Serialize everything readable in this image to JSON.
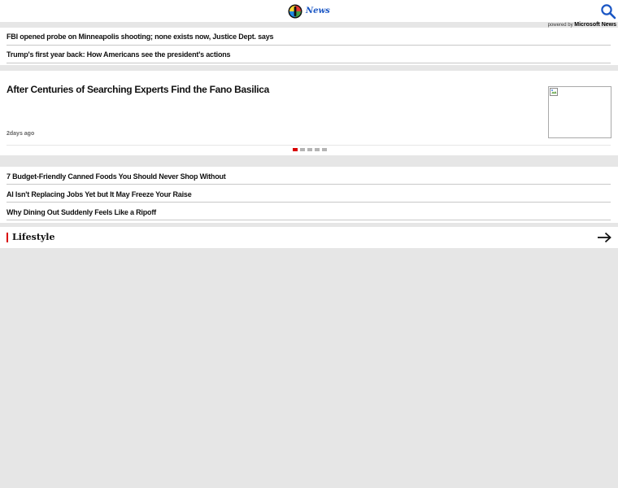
{
  "header": {
    "logo_text": "News",
    "search_icon": "search-icon"
  },
  "powered_by": {
    "prefix": "powered by",
    "brand": "Microsoft News"
  },
  "top_headlines": [
    {
      "title": "FBI opened probe on Minneapolis shooting; none exists now, Justice Dept. says"
    },
    {
      "title": "Trump's first year back: How Americans see the president's actions"
    }
  ],
  "featured": {
    "title": "After Centuries of Searching Experts Find the Fano Basilica",
    "time": "2days ago",
    "image_icon": "broken-image-icon",
    "carousel": {
      "count": 5,
      "active": 0
    }
  },
  "more_headlines": [
    {
      "title": "7 Budget-Friendly Canned Foods You Should Never Shop Without"
    },
    {
      "title": "AI Isn't Replacing Jobs Yet but It May Freeze Your Raise"
    },
    {
      "title": "Why Dining Out Suddenly Feels Like a Ripoff"
    }
  ],
  "section": {
    "title": "Lifestyle",
    "arrow_icon": "arrow-right-icon"
  },
  "colors": {
    "accent": "#d90000",
    "brand_blue": "#1a56c4",
    "background": "#e6e6e6"
  }
}
